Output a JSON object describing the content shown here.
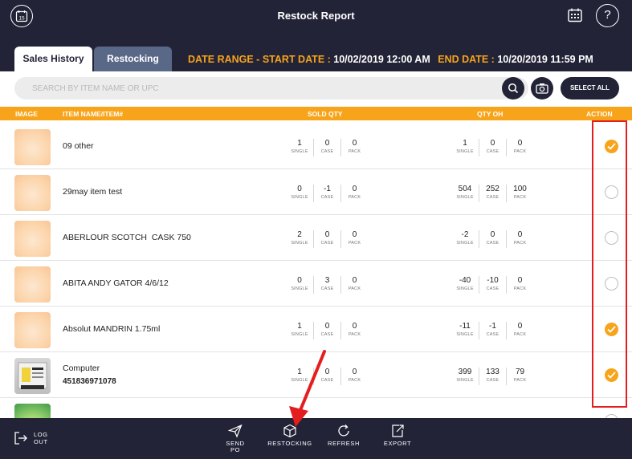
{
  "header": {
    "title": "Restock Report",
    "calendar_left_day": "15",
    "help_symbol": "?"
  },
  "tabs": [
    {
      "label": "Sales History",
      "active": true
    },
    {
      "label": "Restocking",
      "active": false
    }
  ],
  "date_range": {
    "label": "DATE RANGE -",
    "start_label": "START DATE :",
    "start_value": "10/02/2019 12:00 AM",
    "end_label": "END DATE :",
    "end_value": "10/20/2019 11:59 PM"
  },
  "search": {
    "placeholder": "SEARCH BY ITEM NAME OR UPC",
    "select_all_label": "SELECT ALL"
  },
  "columns": {
    "image": "IMAGE",
    "item": "ITEM NAME/ITEM#",
    "sold_qty": "SOLD QTY",
    "qty_oh": "QTY OH",
    "action": "ACTION"
  },
  "units": {
    "single": "SINGLE",
    "case": "CASE",
    "pack": "PACK"
  },
  "rows": [
    {
      "name": "09 other",
      "item_no": "",
      "sold": [
        "1",
        "0",
        "0"
      ],
      "oh": [
        "1",
        "0",
        "0"
      ],
      "checked": true
    },
    {
      "name": "29may item test",
      "item_no": "",
      "sold": [
        "0",
        "-1",
        "0"
      ],
      "oh": [
        "504",
        "252",
        "100"
      ],
      "checked": false
    },
    {
      "name": "ABERLOUR SCOTCH  CASK 750",
      "item_no": "",
      "sold": [
        "2",
        "0",
        "0"
      ],
      "oh": [
        "-2",
        "0",
        "0"
      ],
      "checked": false
    },
    {
      "name": "ABITA ANDY GATOR 4/6/12",
      "item_no": "",
      "sold": [
        "0",
        "3",
        "0"
      ],
      "oh": [
        "-40",
        "-10",
        "0"
      ],
      "checked": false
    },
    {
      "name": "Absolut MANDRIN 1.75ml",
      "item_no": "",
      "sold": [
        "1",
        "0",
        "0"
      ],
      "oh": [
        "-11",
        "-1",
        "0"
      ],
      "checked": true
    },
    {
      "name": "Computer",
      "item_no": "451836971078",
      "sold": [
        "1",
        "0",
        "0"
      ],
      "oh": [
        "399",
        "133",
        "79"
      ],
      "checked": true
    }
  ],
  "bottom": {
    "logout": "LOG OUT",
    "send_po": "SEND PO",
    "restocking": "RESTOCKING",
    "refresh": "REFRESH",
    "export": "EXPORT"
  },
  "colors": {
    "navy": "#232338",
    "accent": "#f7a41b",
    "highlight": "#e41e1e"
  }
}
